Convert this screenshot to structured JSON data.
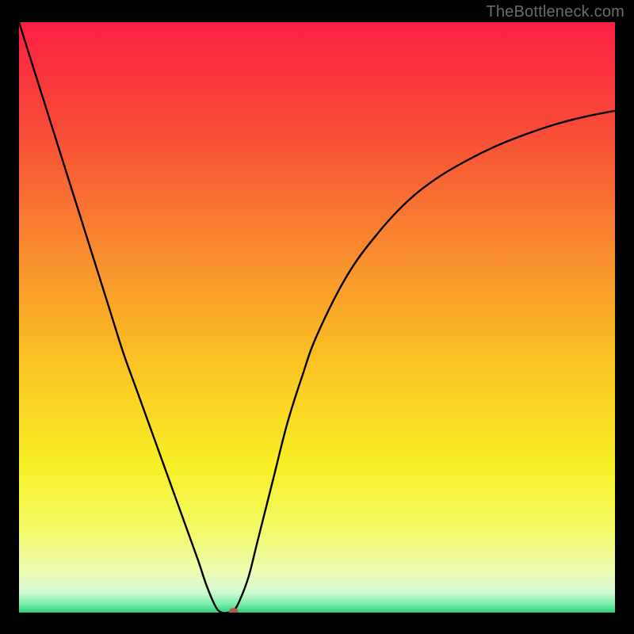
{
  "watermark": "TheBottleneck.com",
  "colors": {
    "frame": "#000000",
    "curve": "#000000",
    "marker": "#b8544e",
    "gradient_stops": [
      {
        "offset": 0.0,
        "color": "#fb2044"
      },
      {
        "offset": 0.18,
        "color": "#f84b37"
      },
      {
        "offset": 0.4,
        "color": "#f98f2e"
      },
      {
        "offset": 0.58,
        "color": "#fbc423"
      },
      {
        "offset": 0.75,
        "color": "#f8ef24"
      },
      {
        "offset": 0.86,
        "color": "#f4fa68"
      },
      {
        "offset": 0.93,
        "color": "#ecfbb0"
      },
      {
        "offset": 0.965,
        "color": "#d4fad4"
      },
      {
        "offset": 0.985,
        "color": "#7ceea8"
      },
      {
        "offset": 1.0,
        "color": "#29d17e"
      }
    ]
  },
  "chart_data": {
    "type": "line",
    "title": "",
    "xlabel": "",
    "ylabel": "",
    "xlim": [
      0,
      100
    ],
    "ylim": [
      0,
      100
    ],
    "grid": false,
    "legend": false,
    "series": [
      {
        "name": "bottleneck-curve",
        "x": [
          0,
          2.5,
          5,
          7.5,
          10,
          12.5,
          15,
          17.5,
          20,
          22.5,
          25,
          27.5,
          30,
          31.5,
          33,
          34,
          35,
          36,
          37,
          38.5,
          40,
          42.5,
          45,
          47.5,
          50,
          55,
          60,
          65,
          70,
          75,
          80,
          85,
          90,
          95,
          100
        ],
        "y": [
          100,
          92,
          84,
          76,
          68,
          60,
          52,
          44,
          37,
          30,
          23,
          16,
          9,
          4.5,
          1,
          0,
          0,
          0.3,
          2,
          6,
          12,
          22,
          32,
          40,
          47,
          57,
          64,
          69.5,
          73.5,
          76.5,
          79,
          81,
          82.7,
          84,
          85
        ]
      }
    ],
    "annotations": [
      {
        "name": "optimal-point",
        "x": 36,
        "y": 0,
        "marker": "circle"
      }
    ]
  }
}
